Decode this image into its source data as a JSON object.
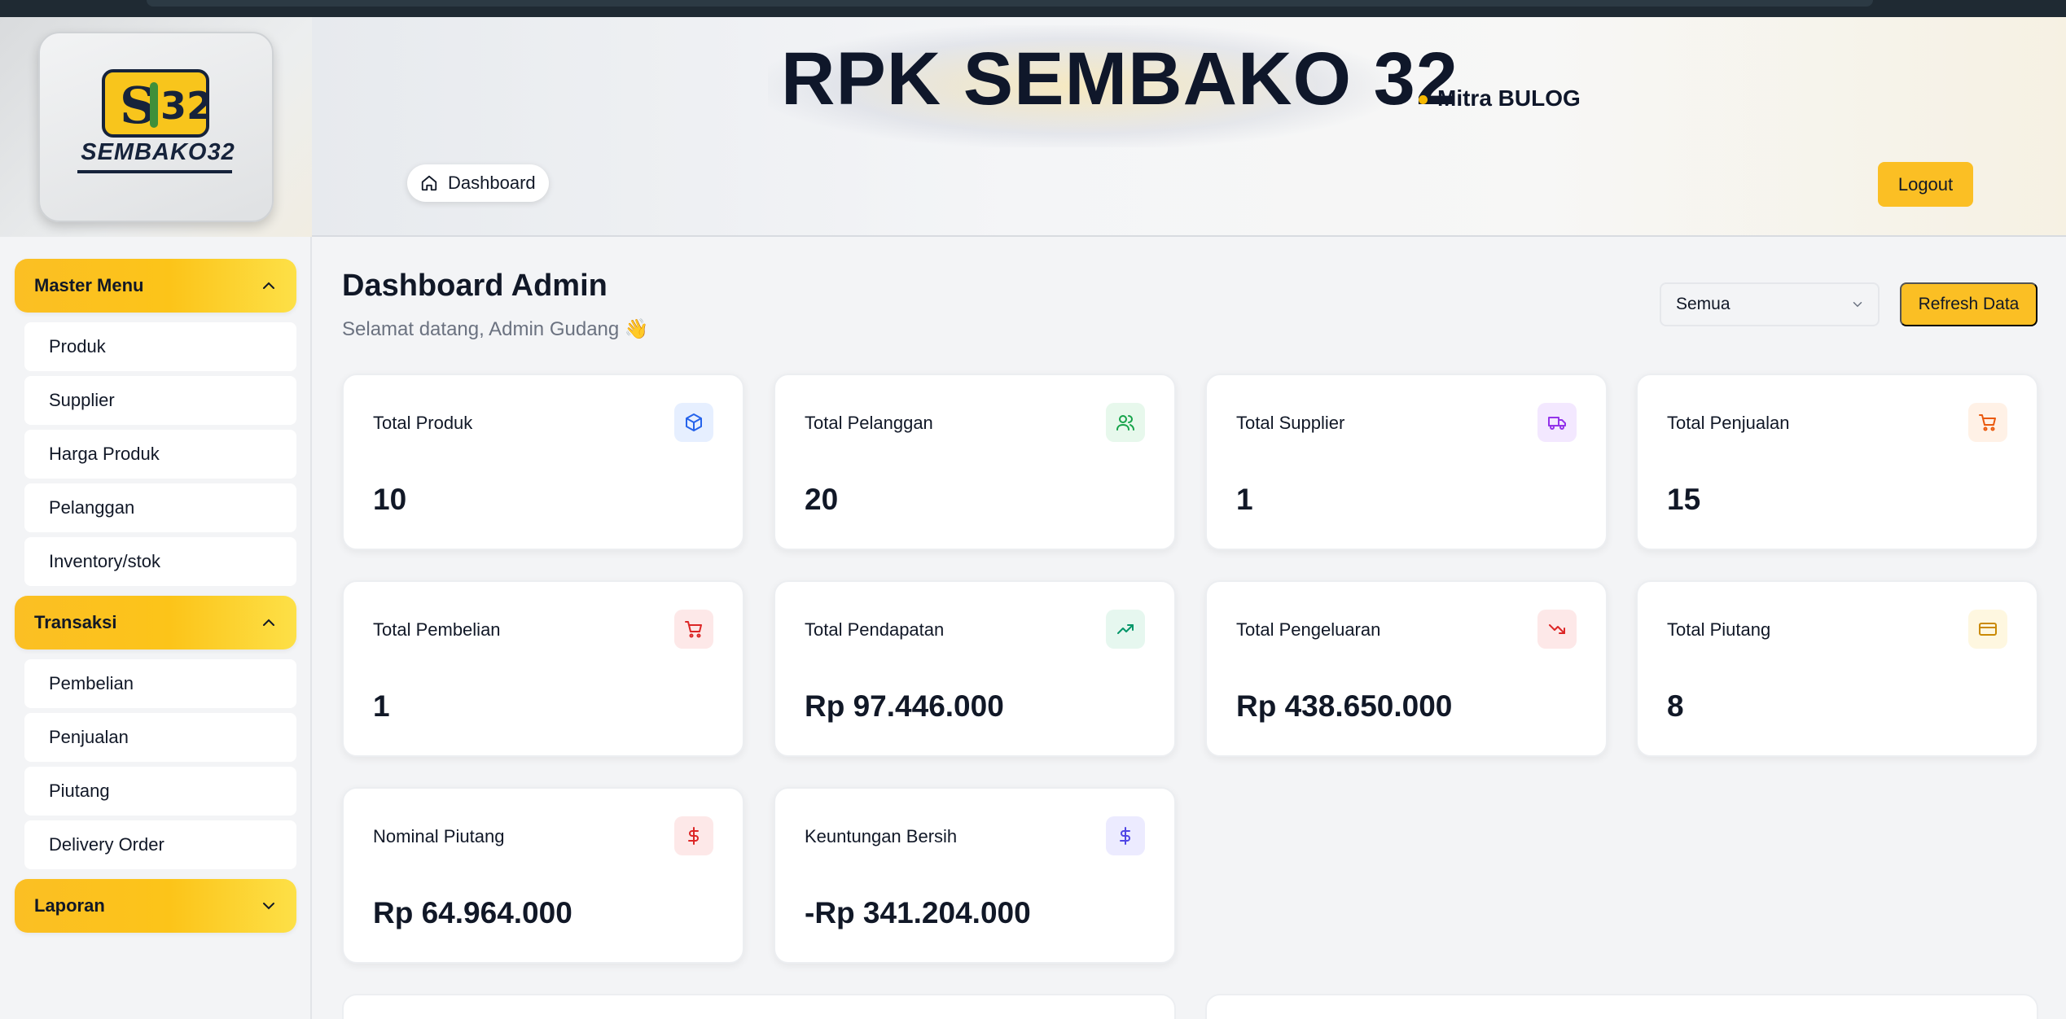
{
  "app": {
    "logo_text": "SEMBAKO32",
    "logo_badge": "S32",
    "title": "RPK SEMBAKO 32",
    "subtitle": "Mitra BULOG"
  },
  "breadcrumb": {
    "label": "Dashboard",
    "icon": "home-icon"
  },
  "header": {
    "logout_label": "Logout"
  },
  "sidebar": {
    "groups": [
      {
        "label": "Master Menu",
        "expanded": true,
        "items": [
          "Produk",
          "Supplier",
          "Harga Produk",
          "Pelanggan",
          "Inventory/stok"
        ]
      },
      {
        "label": "Transaksi",
        "expanded": true,
        "items": [
          "Pembelian",
          "Penjualan",
          "Piutang",
          "Delivery Order"
        ]
      },
      {
        "label": "Laporan",
        "expanded": false,
        "items": []
      }
    ]
  },
  "main": {
    "title": "Dashboard Admin",
    "subtitle": "Selamat datang, Admin Gudang 👋",
    "filter_value": "Semua",
    "refresh_label": "Refresh Data",
    "cards": [
      {
        "label": "Total Produk",
        "value": "10",
        "icon": "box-icon",
        "icon_color": "#2563eb",
        "icon_bg": "#e6efff"
      },
      {
        "label": "Total Pelanggan",
        "value": "20",
        "icon": "users-icon",
        "icon_color": "#16a34a",
        "icon_bg": "#e7f8ec"
      },
      {
        "label": "Total Supplier",
        "value": "1",
        "icon": "truck-icon",
        "icon_color": "#9333ea",
        "icon_bg": "#f3e8ff"
      },
      {
        "label": "Total Penjualan",
        "value": "15",
        "icon": "cart-icon",
        "icon_color": "#ea580c",
        "icon_bg": "#fff1e6"
      },
      {
        "label": "Total Pembelian",
        "value": "1",
        "icon": "cart-icon",
        "icon_color": "#dc2626",
        "icon_bg": "#fde8e8"
      },
      {
        "label": "Total Pendapatan",
        "value": "Rp 97.446.000",
        "icon": "trending-up-icon",
        "icon_color": "#059669",
        "icon_bg": "#e6f7ef"
      },
      {
        "label": "Total Pengeluaran",
        "value": "Rp 438.650.000",
        "icon": "trending-down-icon",
        "icon_color": "#dc2626",
        "icon_bg": "#fde8e8"
      },
      {
        "label": "Total Piutang",
        "value": "8",
        "icon": "credit-card-icon",
        "icon_color": "#ca8a04",
        "icon_bg": "#fef7e0"
      },
      {
        "label": "Nominal Piutang",
        "value": "Rp 64.964.000",
        "icon": "dollar-icon",
        "icon_color": "#dc2626",
        "icon_bg": "#fde8e8"
      },
      {
        "label": "Keuntungan Bersih",
        "value": "-Rp 341.204.000",
        "icon": "dollar-icon",
        "icon_color": "#4f46e5",
        "icon_bg": "#ecebff"
      }
    ]
  }
}
